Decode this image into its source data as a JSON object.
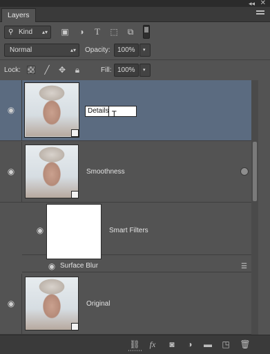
{
  "panel": {
    "tab_label": "Layers",
    "collapse_glyph": "◂◂",
    "close_glyph": "✕"
  },
  "filter": {
    "kind_label": "Kind",
    "icons": [
      "image-filter-icon",
      "adjustment-filter-icon",
      "type-filter-icon",
      "shape-filter-icon",
      "smart-object-filter-icon"
    ]
  },
  "blend": {
    "mode": "Normal",
    "opacity_label": "Opacity:",
    "opacity_value": "100%"
  },
  "lock": {
    "label": "Lock:",
    "fill_label": "Fill:",
    "fill_value": "100%"
  },
  "layers": {
    "details": {
      "name_input": "Details"
    },
    "smoothness": {
      "name": "Smoothness"
    },
    "smart_filters": {
      "name": "Smart Filters"
    },
    "surface_blur": {
      "name": "Surface Blur"
    },
    "original": {
      "name": "Original"
    }
  },
  "colors": {
    "panel_bg": "#535353",
    "selected_row": "#5b6b80"
  }
}
